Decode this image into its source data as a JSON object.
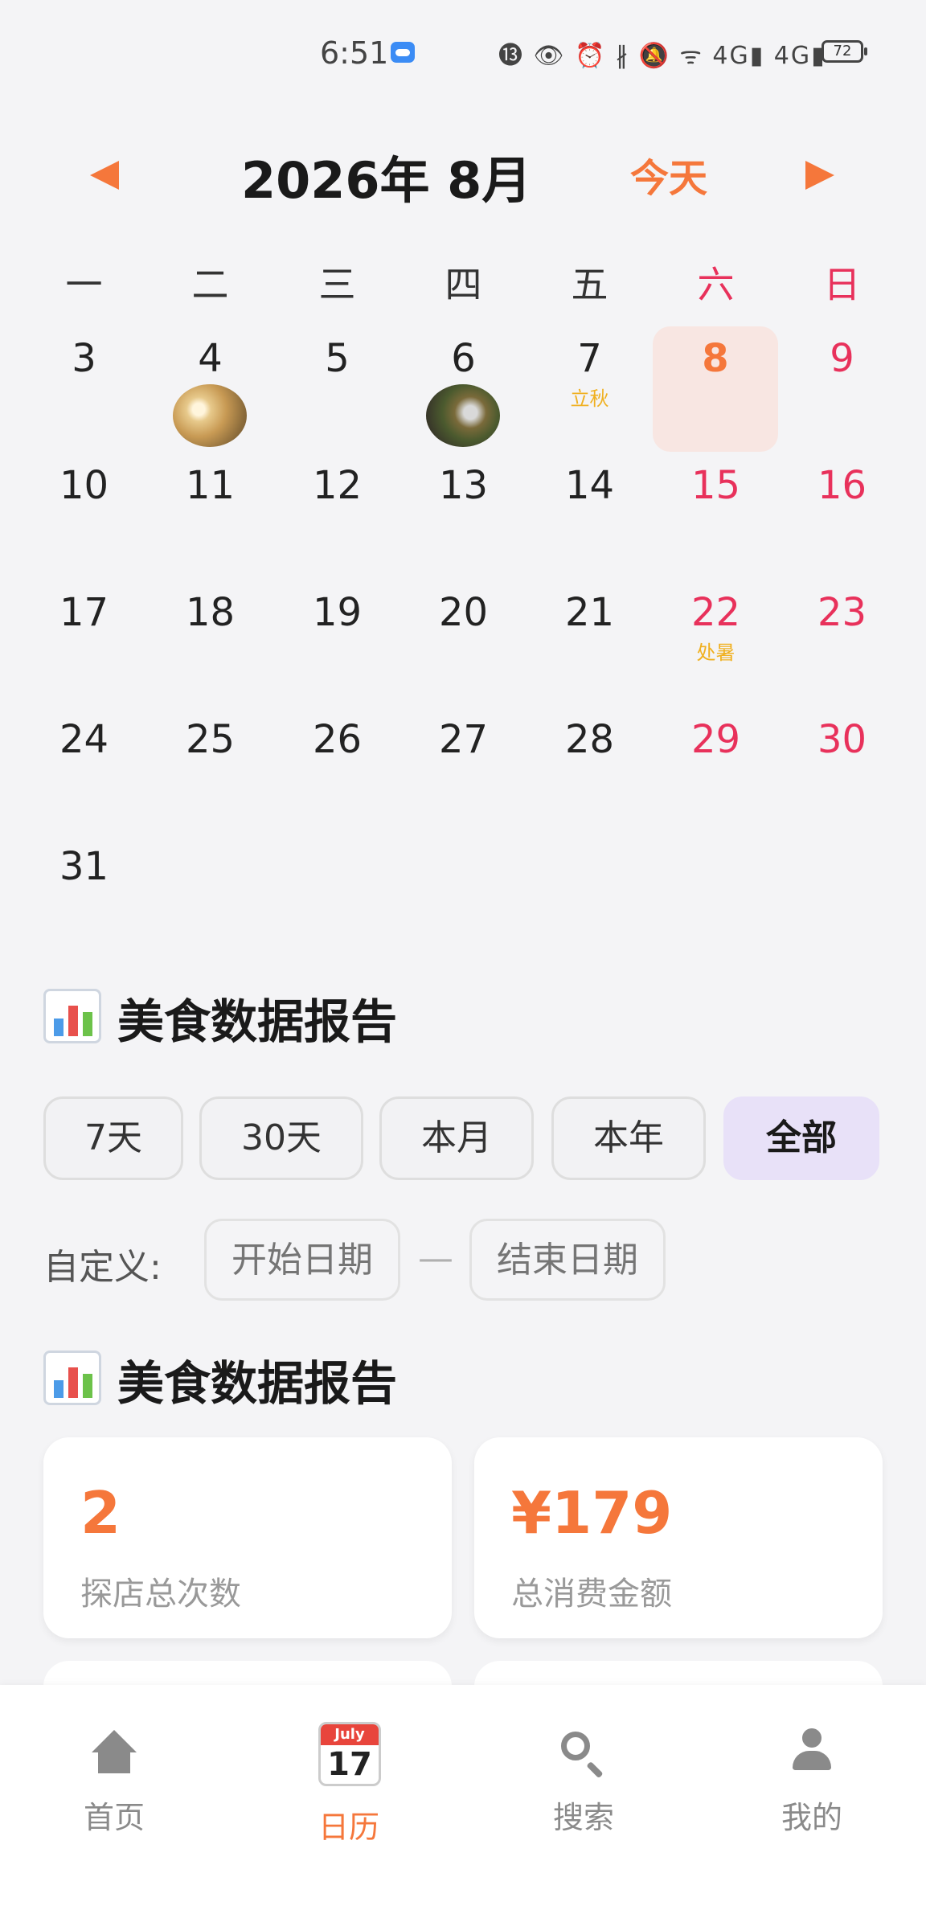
{
  "status_bar": {
    "time": "6:51",
    "icons": "⓭ 👁 ⏰ ∦ 🔕 ᯤ 4G▮ 4G▮",
    "battery": "72"
  },
  "calendar": {
    "title": "2026年 8月",
    "today_label": "今天",
    "weekdays": [
      "一",
      "二",
      "三",
      "四",
      "五",
      "六",
      "日"
    ],
    "days": [
      {
        "num": "3"
      },
      {
        "num": "4",
        "thumb": "dumpling-photo"
      },
      {
        "num": "5"
      },
      {
        "num": "6",
        "thumb": "grill-photo"
      },
      {
        "num": "7",
        "term": "立秋"
      },
      {
        "num": "8",
        "today": true
      },
      {
        "num": "9"
      },
      {
        "num": "10"
      },
      {
        "num": "11"
      },
      {
        "num": "12"
      },
      {
        "num": "13"
      },
      {
        "num": "14"
      },
      {
        "num": "15"
      },
      {
        "num": "16"
      },
      {
        "num": "17"
      },
      {
        "num": "18"
      },
      {
        "num": "19"
      },
      {
        "num": "20"
      },
      {
        "num": "21"
      },
      {
        "num": "22",
        "term": "处暑"
      },
      {
        "num": "23"
      },
      {
        "num": "24"
      },
      {
        "num": "25"
      },
      {
        "num": "26"
      },
      {
        "num": "27"
      },
      {
        "num": "28"
      },
      {
        "num": "29"
      },
      {
        "num": "30"
      },
      {
        "num": "31"
      }
    ],
    "colors": {
      "accent": "#f5773b",
      "weekend": "#e8315b",
      "solar_term": "#f0b020",
      "today_bg": "#f8e6e2"
    }
  },
  "report": {
    "title": "美食数据报告",
    "filters": [
      "7天",
      "30天",
      "本月",
      "本年",
      "全部"
    ],
    "active_filter": "全部",
    "custom_label": "自定义:",
    "start_placeholder": "开始日期",
    "separator": "—",
    "end_placeholder": "结束日期"
  },
  "stats": {
    "title": "美食数据报告",
    "cards": [
      {
        "value": "2",
        "label": "探店总次数"
      },
      {
        "value": "¥179",
        "label": "总消费金额"
      }
    ]
  },
  "bottom_nav": {
    "items": [
      {
        "label": "首页",
        "icon": "home-icon"
      },
      {
        "label": "日历",
        "icon": "calendar-icon",
        "active": true
      },
      {
        "label": "搜索",
        "icon": "search-icon"
      },
      {
        "label": "我的",
        "icon": "user-icon"
      }
    ],
    "calendar_icon_month": "July",
    "calendar_icon_day": "17"
  }
}
